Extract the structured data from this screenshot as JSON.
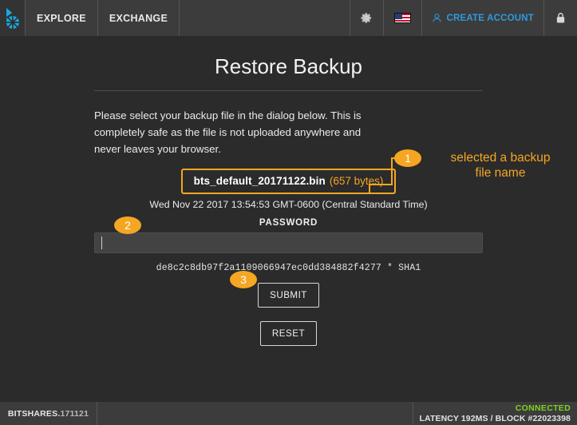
{
  "header": {
    "logo": "bitshares-logo",
    "nav": [
      {
        "label": "EXPLORE"
      },
      {
        "label": "EXCHANGE"
      }
    ],
    "settings_icon": "gear-icon",
    "language_flag": "us-flag-icon",
    "create_account_label": "CREATE ACCOUNT",
    "create_account_icon": "person-icon",
    "lock_icon": "lock-icon",
    "accent_blue": "#2e9ae0"
  },
  "main": {
    "title": "Restore Backup",
    "intro": "Please select your backup file in the dialog below. This is completely safe as the file is not uploaded anywhere and never leaves your browser.",
    "file": {
      "name": "bts_default_20171122.bin",
      "size": "(657 bytes)",
      "date": "Wed Nov 22 2017 13:54:53 GMT-0600 (Central Standard Time)"
    },
    "password": {
      "label": "PASSWORD",
      "value": "",
      "placeholder": ""
    },
    "hash": "de8c2c8db97f2a1109066947ec0dd384882f4277 * SHA1",
    "submit_label": "SUBMIT",
    "reset_label": "RESET"
  },
  "annotations": {
    "accent": "#f5a623",
    "items": [
      {
        "number": "1",
        "text": "selected a backup\nfile name"
      },
      {
        "number": "2",
        "text": ""
      },
      {
        "number": "3",
        "text": ""
      }
    ],
    "note_1_line_1": "selected a backup",
    "note_1_line_2": "file name"
  },
  "footer": {
    "app_name": "BITSHARES.",
    "app_version": "171121",
    "status": "CONNECTED",
    "status_color": "#7ed321",
    "latency_label": "LATENCY",
    "latency_value": "192MS",
    "separator": "/",
    "block_label": "BLOCK",
    "block_value": "#22023398",
    "info_line": "LATENCY 192MS / BLOCK #22023398"
  }
}
